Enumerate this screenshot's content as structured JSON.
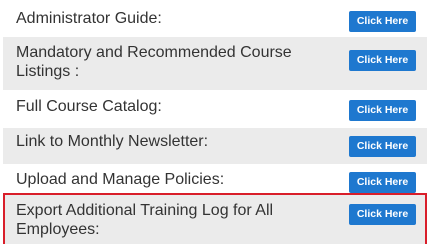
{
  "button_label": "Click Here",
  "items": [
    {
      "label": "Administrator Guide:"
    },
    {
      "label": "Mandatory and Recommended Course Listings :"
    },
    {
      "label": "Full Course Catalog:"
    },
    {
      "label": "Link to Monthly Newsletter:"
    },
    {
      "label": "Upload and Manage Policies:"
    },
    {
      "label": "Export Additional Training Log for All Employees:"
    }
  ],
  "colors": {
    "button": "#1e78cf",
    "row_shade": "#ebebeb",
    "highlight_border": "#d91e2a",
    "text": "#333333"
  }
}
